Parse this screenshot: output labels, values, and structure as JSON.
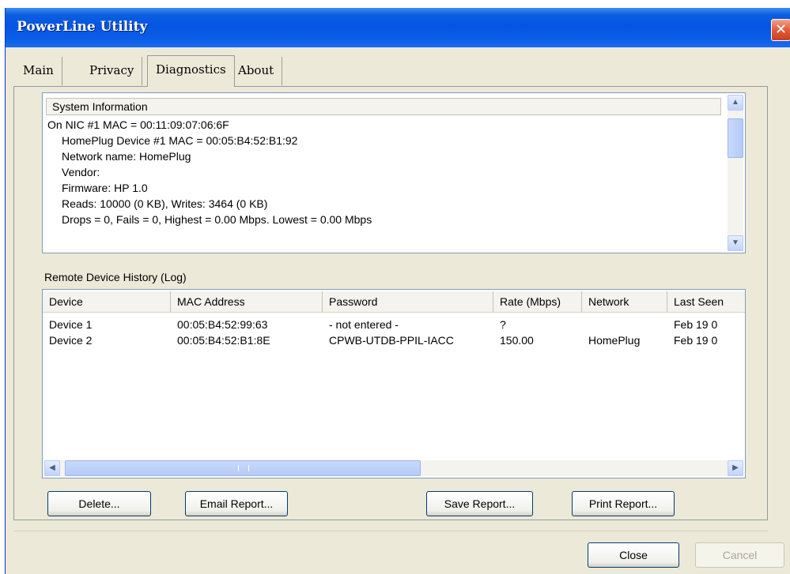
{
  "window": {
    "title": "PowerLine Utility",
    "close_glyph": "✕"
  },
  "tabs": [
    {
      "label": "Main"
    },
    {
      "label": "Privacy"
    },
    {
      "label": "Diagnostics"
    },
    {
      "label": "About"
    }
  ],
  "active_tab": "Diagnostics",
  "system_info": {
    "header": "System Information",
    "lines": [
      "On NIC #1 MAC = 00:11:09:07:06:6F",
      "HomePlug Device #1 MAC = 00:05:B4:52:B1:92",
      "Network name: HomePlug",
      "Vendor:",
      "Firmware: HP 1.0",
      "Reads: 10000 (0 KB), Writes: 3464 (0 KB)",
      "Drops = 0, Fails = 0, Highest = 0.00 Mbps. Lowest = 0.00 Mbps"
    ]
  },
  "remote_history": {
    "label": "Remote Device History (Log)",
    "columns": [
      "Device",
      "MAC Address",
      "Password",
      "Rate (Mbps)",
      "Network",
      "Last Seen"
    ],
    "rows": [
      [
        "Device 1",
        "00:05:B4:52:99:63",
        "- not entered -",
        "?",
        "",
        "Feb 19 0"
      ],
      [
        "Device 2",
        "00:05:B4:52:B1:8E",
        "CPWB-UTDB-PPIL-IACC",
        "150.00",
        "HomePlug",
        "Feb 19 0"
      ]
    ]
  },
  "buttons": {
    "delete": "Delete...",
    "email_report": "Email Report...",
    "save_report": "Save Report...",
    "print_report": "Print Report...",
    "close": "Close",
    "cancel": "Cancel"
  },
  "colors": {
    "titlebar": "#0554e3",
    "close_button": "#e35a3a",
    "window_bg": "#ece9d8"
  },
  "icons": {
    "scroll_up": "▲",
    "scroll_down": "▼",
    "scroll_left": "◀",
    "scroll_right": "▶"
  }
}
